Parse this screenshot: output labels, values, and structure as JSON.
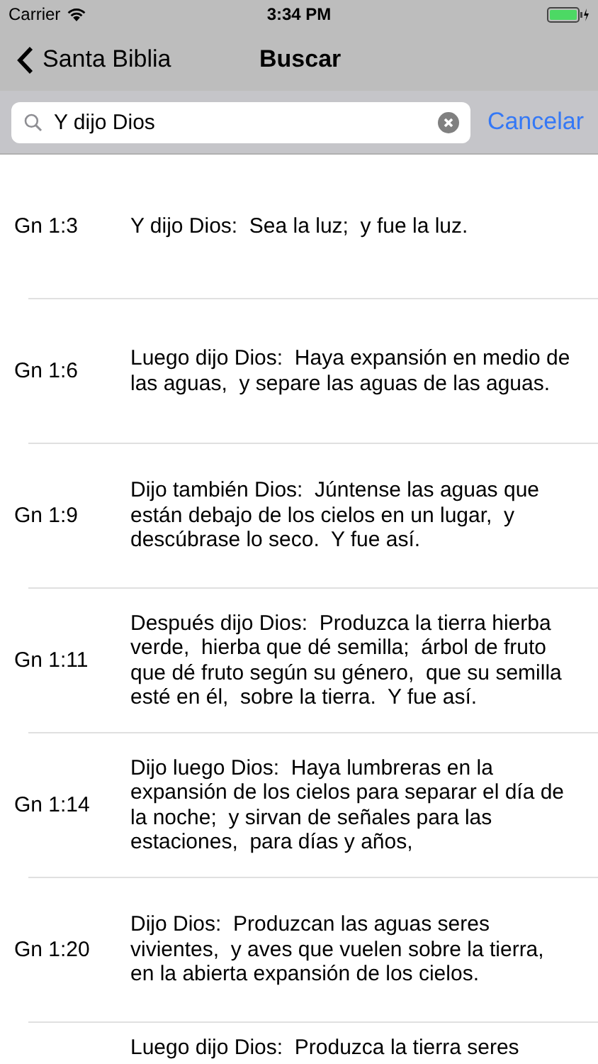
{
  "status_bar": {
    "carrier": "Carrier",
    "time": "3:34 PM"
  },
  "nav": {
    "back": "Santa Biblia",
    "title": "Buscar"
  },
  "search": {
    "value": "Y dijo Dios",
    "cancel": "Cancelar"
  },
  "results": [
    {
      "ref": "Gn 1:3",
      "text": "Y dijo Dios:  Sea la luz;  y fue la luz."
    },
    {
      "ref": "Gn 1:6",
      "text": "Luego dijo Dios:  Haya expansión en medio de las aguas,  y separe las aguas de las aguas."
    },
    {
      "ref": "Gn 1:9",
      "text": "Dijo también Dios:  Júntense las aguas que están debajo de los cielos en un lugar,  y descúbrase lo seco.  Y fue así."
    },
    {
      "ref": "Gn 1:11",
      "text": "Después dijo Dios:  Produzca la tierra hierba verde,  hierba que dé semilla;  árbol de fruto que dé fruto según su género,  que su semilla esté en él,  sobre la tierra.  Y fue así."
    },
    {
      "ref": "Gn 1:14",
      "text": "Dijo luego Dios:  Haya lumbreras en la expansión de los cielos para separar el día de la noche;  y sirvan de señales para las estaciones,  para días y años,"
    },
    {
      "ref": "Gn 1:20",
      "text": "Dijo Dios:  Produzcan las aguas seres vivientes,  y aves que vuelen sobre la tierra,  en la abierta expansión de los cielos."
    },
    {
      "text": "Luego dijo Dios:  Produzca la tierra seres"
    }
  ]
}
